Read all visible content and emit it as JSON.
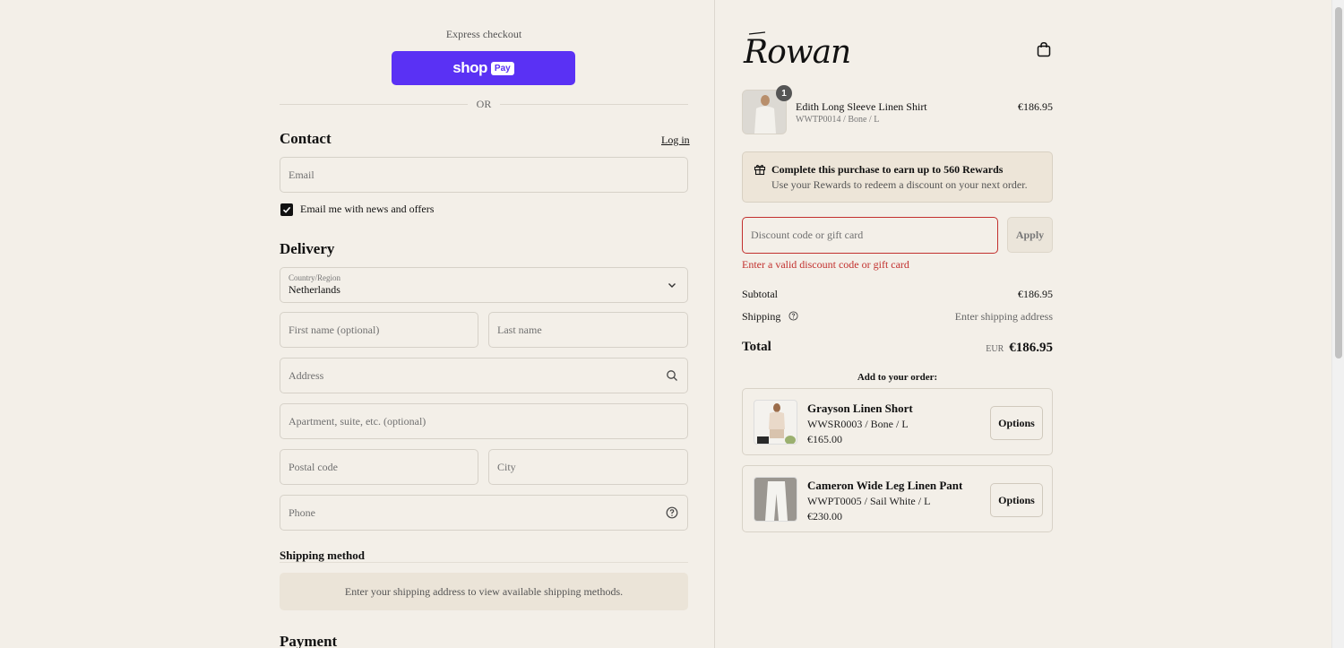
{
  "express": {
    "label": "Express checkout",
    "shop_pay": {
      "shop_text": "shop",
      "pay_text": "Pay",
      "color": "#5a31f4"
    },
    "or_label": "OR"
  },
  "contact": {
    "title": "Contact",
    "login_label": "Log in",
    "email_placeholder": "Email",
    "newsletter_label": "Email me with news and offers",
    "newsletter_checked": true
  },
  "delivery": {
    "title": "Delivery",
    "country_label": "Country/Region",
    "country_value": "Netherlands",
    "first_name_placeholder": "First name (optional)",
    "last_name_placeholder": "Last name",
    "address_placeholder": "Address",
    "apartment_placeholder": "Apartment, suite, etc. (optional)",
    "postal_placeholder": "Postal code",
    "city_placeholder": "City",
    "phone_placeholder": "Phone"
  },
  "shipping_method": {
    "title": "Shipping method",
    "message": "Enter your shipping address to view available shipping methods."
  },
  "payment": {
    "title": "Payment"
  },
  "summary": {
    "brand": "Rowan",
    "item": {
      "name": "Edith Long Sleeve Linen Shirt",
      "variant": "WWTP0014 / Bone / L",
      "price": "€186.95",
      "quantity": "1"
    },
    "rewards": {
      "title": "Complete this purchase to earn up to 560 Rewards",
      "subtitle": "Use your Rewards to redeem a discount on your next order."
    },
    "discount": {
      "placeholder": "Discount code or gift card",
      "apply_label": "Apply",
      "error": "Enter a valid discount code or gift card",
      "error_color": "#c2302e"
    },
    "subtotal_label": "Subtotal",
    "subtotal_value": "€186.95",
    "shipping_label": "Shipping",
    "shipping_value": "Enter shipping address",
    "total_label": "Total",
    "total_currency": "EUR",
    "total_value": "€186.95"
  },
  "upsell": {
    "title": "Add to your order:",
    "items": [
      {
        "name": "Grayson Linen Short",
        "variant": "WWSR0003 / Bone / L",
        "price": "€165.00",
        "button": "Options"
      },
      {
        "name": "Cameron Wide Leg Linen Pant",
        "variant": "WWPT0005 / Sail White / L",
        "price": "€230.00",
        "button": "Options"
      }
    ]
  }
}
